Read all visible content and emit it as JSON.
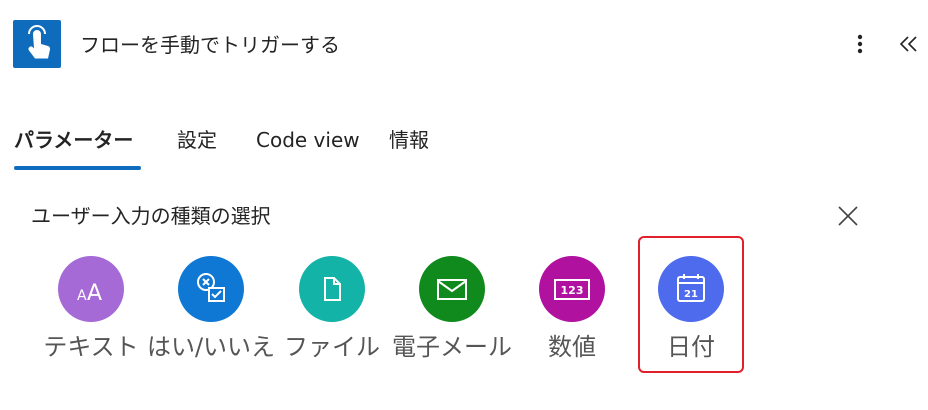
{
  "header": {
    "title": "フローを手動でトリガーする",
    "icon": "touch-hand-icon",
    "icon_color": "#0f6cbd"
  },
  "tabs": [
    {
      "label": "パラメーター",
      "active": true
    },
    {
      "label": "設定",
      "active": false
    },
    {
      "label": "Code view",
      "active": false
    },
    {
      "label": "情報",
      "active": false
    }
  ],
  "input_type_picker": {
    "title": "ユーザー入力の種類の選択",
    "options": [
      {
        "label": "テキスト",
        "icon": "text-icon",
        "color": "#a56ad6"
      },
      {
        "label": "はい/いいえ",
        "icon": "yes-no-icon",
        "color": "#0f78d4"
      },
      {
        "label": "ファイル",
        "icon": "file-icon",
        "color": "#14b3a8"
      },
      {
        "label": "電子メール",
        "icon": "email-icon",
        "color": "#108a1c"
      },
      {
        "label": "数値",
        "icon": "number-icon",
        "color": "#b0119e"
      },
      {
        "label": "日付",
        "icon": "calendar-icon",
        "color": "#4f6bed"
      }
    ],
    "highlighted_option": "日付",
    "highlight_color": "#e0202a"
  }
}
